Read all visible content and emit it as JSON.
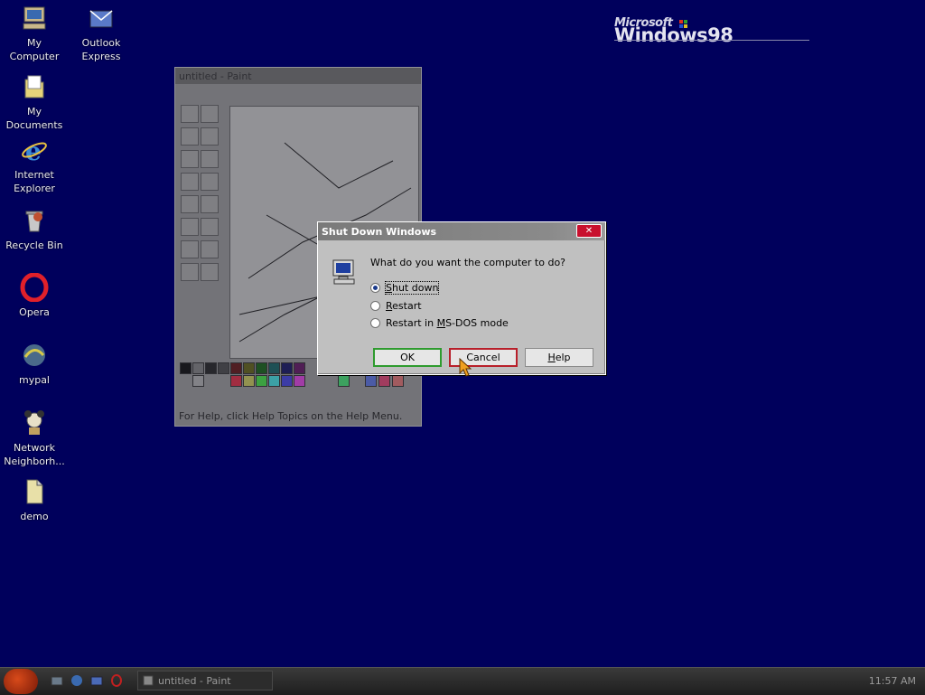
{
  "desktop": {
    "icons": [
      {
        "label": "My Computer"
      },
      {
        "label": "Outlook Express"
      },
      {
        "label": "My Documents"
      },
      {
        "label": "Internet Explorer"
      },
      {
        "label": "Recycle Bin"
      },
      {
        "label": "Opera"
      },
      {
        "label": "mypal"
      },
      {
        "label": "Network Neighborh..."
      },
      {
        "label": "demo"
      }
    ],
    "logo": {
      "brand": "Microsoft",
      "product": "Windows98"
    }
  },
  "paint": {
    "title": "untitled - Paint",
    "status": "For Help, click Help Topics on the Help Menu."
  },
  "dialog": {
    "title": "Shut Down Windows",
    "close_label": "✕",
    "question": "What do you want the computer to do?",
    "options": [
      {
        "pre": "",
        "acc": "S",
        "post": "hut down",
        "selected": true
      },
      {
        "pre": "",
        "acc": "R",
        "post": "estart",
        "selected": false
      },
      {
        "pre": "Restart in ",
        "acc": "M",
        "post": "S-DOS mode",
        "selected": false
      }
    ],
    "buttons": {
      "ok": "OK",
      "cancel": "Cancel",
      "help_acc": "H",
      "help_rest": "elp"
    }
  },
  "taskbar": {
    "task_label": "untitled - Paint",
    "clock": "11:57 AM"
  },
  "colors": {
    "desktop": "#00005c",
    "ok_border": "#2e9b2e",
    "cancel_border": "#b81f2a",
    "close_button": "#c8102e"
  }
}
